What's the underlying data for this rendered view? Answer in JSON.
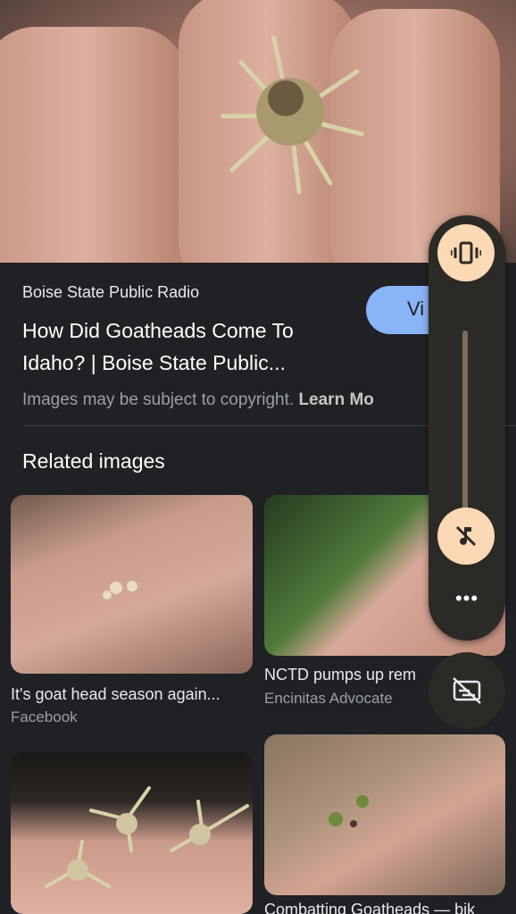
{
  "result": {
    "source": "Boise State Public Radio",
    "title": "How Did Goatheads Come To Idaho? | Boise State Public...",
    "visit_label": "Vi",
    "copyright_text": "Images may be subject to copyright. ",
    "learn_more": "Learn Mo"
  },
  "related": {
    "heading": "Related images",
    "items": [
      {
        "title": "It's goat head season again...",
        "source": "Facebook"
      },
      {
        "title": "NCTD pumps up rem",
        "source": "Encinitas Advocate"
      },
      {
        "title": "",
        "source": ""
      },
      {
        "title": "Combatting Goatheads — bik",
        "source": ""
      }
    ]
  },
  "volume_panel": {
    "mode_icon": "vibrate-icon",
    "media_icon": "music-muted-icon",
    "more_icon": "more-horiz-icon",
    "captions_icon": "captions-off-icon",
    "level": 0.0
  },
  "colors": {
    "accent": "#8ab4f8",
    "panel_button": "#fbd9b4",
    "panel_bg": "#2c2a27"
  }
}
